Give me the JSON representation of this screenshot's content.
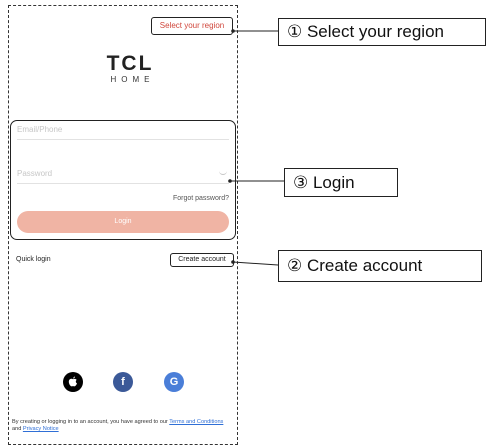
{
  "app": {
    "select_region": "Select your region",
    "logo_main": "TCL",
    "logo_sub": "HOME",
    "email_placeholder": "Email/Phone",
    "password_placeholder": "Password",
    "forgot_password": "Forgot password?",
    "login_button": "Login",
    "quick_login": "Quick login",
    "create_account": "Create account",
    "social": {
      "apple_icon": "apple-icon",
      "facebook_icon": "facebook-icon",
      "facebook_glyph": "f",
      "google_icon": "google-icon",
      "google_glyph": "G"
    },
    "terms": {
      "prefix": "By creating or logging in to an account, you have agreed to our ",
      "terms_link": "Terms and Conditions",
      "and": " and ",
      "privacy_link": "Privacy Notice"
    }
  },
  "callouts": {
    "region": "① Select your region",
    "login": "③ Login",
    "create": "② Create account"
  },
  "colors": {
    "accent": "#d0463b",
    "login_button": "#f0b4a4",
    "link": "#2f6fd6",
    "facebook": "#3b5998",
    "google": "#4a7ed8"
  }
}
